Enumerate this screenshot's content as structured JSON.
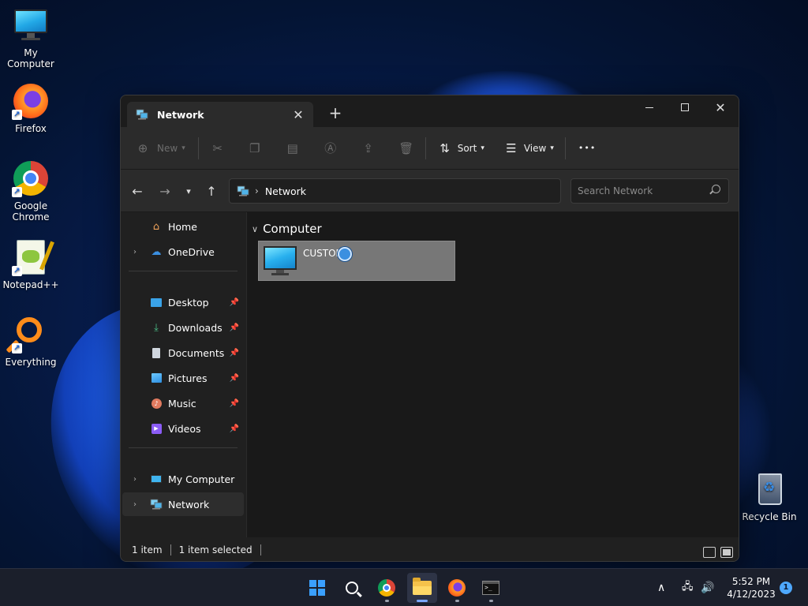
{
  "desktop": {
    "icons": [
      {
        "label": "My Computer",
        "icon": "computer-icon"
      },
      {
        "label": "Firefox",
        "icon": "firefox-icon"
      },
      {
        "label": "Google\nChrome",
        "icon": "chrome-icon"
      },
      {
        "label": "Notepad++",
        "icon": "notepadpp-icon"
      },
      {
        "label": "Everything",
        "icon": "everything-icon"
      },
      {
        "label": "Recycle Bin",
        "icon": "recycle-bin-icon"
      }
    ]
  },
  "window": {
    "tab_title": "Network",
    "new_tab": "+",
    "close_tab": "✕",
    "controls": {
      "close": "✕"
    }
  },
  "toolbar": {
    "new_label": "New",
    "sort_label": "Sort",
    "view_label": "View",
    "more_label": "•••"
  },
  "address": {
    "crumbs": [
      "Network"
    ],
    "search_placeholder": "Search Network"
  },
  "sidebar": {
    "items": [
      {
        "label": "Home",
        "icon": "home-icon"
      },
      {
        "label": "OneDrive",
        "icon": "onedrive-icon"
      },
      {
        "label": "Desktop",
        "icon": "desktop-folder-icon",
        "pinned": true
      },
      {
        "label": "Downloads",
        "icon": "downloads-icon",
        "pinned": true
      },
      {
        "label": "Documents",
        "icon": "documents-icon",
        "pinned": true
      },
      {
        "label": "Pictures",
        "icon": "pictures-icon",
        "pinned": true
      },
      {
        "label": "Music",
        "icon": "music-icon",
        "pinned": true
      },
      {
        "label": "Videos",
        "icon": "videos-icon",
        "pinned": true
      },
      {
        "label": "My Computer",
        "icon": "computer-icon"
      },
      {
        "label": "Network",
        "icon": "network-icon",
        "selected": true
      }
    ]
  },
  "content": {
    "group_header": "Computer",
    "items": [
      {
        "label": "CUSTOM",
        "icon": "computer-icon",
        "selected": true
      }
    ]
  },
  "statusbar": {
    "item_count": "1 item",
    "selection": "1 item selected"
  },
  "taskbar": {
    "apps": [
      "start",
      "search",
      "chrome",
      "file-explorer",
      "firefox",
      "terminal"
    ],
    "time": "5:52 PM",
    "date": "4/12/2023",
    "notification_count": "1"
  },
  "colors": {
    "window_bg": "#202020",
    "accent": "#3aa0ff",
    "selection": "#777777"
  }
}
